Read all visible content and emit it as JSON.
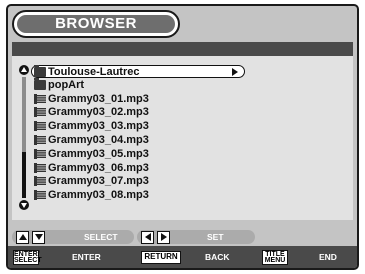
{
  "title": "BROWSER",
  "list": {
    "selected": {
      "label": "Toulouse-Lautrec",
      "icon": "folder-icon"
    },
    "items": [
      {
        "label": "popArt",
        "icon": "folder-icon"
      },
      {
        "label": "Grammy03_01.mp3",
        "icon": "music-file-icon"
      },
      {
        "label": "Grammy03_02.mp3",
        "icon": "music-file-icon"
      },
      {
        "label": "Grammy03_03.mp3",
        "icon": "music-file-icon"
      },
      {
        "label": "Grammy03_04.mp3",
        "icon": "music-file-icon"
      },
      {
        "label": "Grammy03_05.mp3",
        "icon": "music-file-icon"
      },
      {
        "label": "Grammy03_06.mp3",
        "icon": "music-file-icon"
      },
      {
        "label": "Grammy03_07.mp3",
        "icon": "music-file-icon"
      },
      {
        "label": "Grammy03_08.mp3",
        "icon": "music-file-icon"
      }
    ]
  },
  "legend": {
    "row1": {
      "select": "SELECT",
      "set": "SET"
    },
    "row2": {
      "enter_key": "ENTER/ SELECT",
      "enter": "ENTER",
      "return_key": "RETURN",
      "back": "BACK",
      "title_key": "TITLE MENU",
      "end": "END"
    }
  }
}
